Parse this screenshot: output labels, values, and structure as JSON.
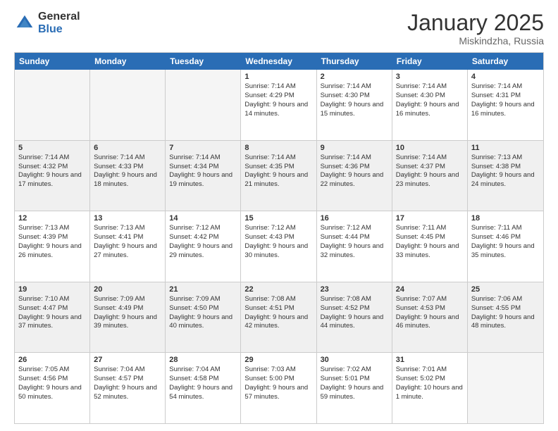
{
  "logo": {
    "general": "General",
    "blue": "Blue"
  },
  "title": "January 2025",
  "subtitle": "Miskindzha, Russia",
  "days": [
    "Sunday",
    "Monday",
    "Tuesday",
    "Wednesday",
    "Thursday",
    "Friday",
    "Saturday"
  ],
  "rows": [
    [
      {
        "day": "",
        "empty": true
      },
      {
        "day": "",
        "empty": true
      },
      {
        "day": "",
        "empty": true
      },
      {
        "day": "1",
        "sunrise": "Sunrise: 7:14 AM",
        "sunset": "Sunset: 4:29 PM",
        "daylight": "Daylight: 9 hours and 14 minutes."
      },
      {
        "day": "2",
        "sunrise": "Sunrise: 7:14 AM",
        "sunset": "Sunset: 4:30 PM",
        "daylight": "Daylight: 9 hours and 15 minutes."
      },
      {
        "day": "3",
        "sunrise": "Sunrise: 7:14 AM",
        "sunset": "Sunset: 4:30 PM",
        "daylight": "Daylight: 9 hours and 16 minutes."
      },
      {
        "day": "4",
        "sunrise": "Sunrise: 7:14 AM",
        "sunset": "Sunset: 4:31 PM",
        "daylight": "Daylight: 9 hours and 16 minutes."
      }
    ],
    [
      {
        "day": "5",
        "sunrise": "Sunrise: 7:14 AM",
        "sunset": "Sunset: 4:32 PM",
        "daylight": "Daylight: 9 hours and 17 minutes."
      },
      {
        "day": "6",
        "sunrise": "Sunrise: 7:14 AM",
        "sunset": "Sunset: 4:33 PM",
        "daylight": "Daylight: 9 hours and 18 minutes."
      },
      {
        "day": "7",
        "sunrise": "Sunrise: 7:14 AM",
        "sunset": "Sunset: 4:34 PM",
        "daylight": "Daylight: 9 hours and 19 minutes."
      },
      {
        "day": "8",
        "sunrise": "Sunrise: 7:14 AM",
        "sunset": "Sunset: 4:35 PM",
        "daylight": "Daylight: 9 hours and 21 minutes."
      },
      {
        "day": "9",
        "sunrise": "Sunrise: 7:14 AM",
        "sunset": "Sunset: 4:36 PM",
        "daylight": "Daylight: 9 hours and 22 minutes."
      },
      {
        "day": "10",
        "sunrise": "Sunrise: 7:14 AM",
        "sunset": "Sunset: 4:37 PM",
        "daylight": "Daylight: 9 hours and 23 minutes."
      },
      {
        "day": "11",
        "sunrise": "Sunrise: 7:13 AM",
        "sunset": "Sunset: 4:38 PM",
        "daylight": "Daylight: 9 hours and 24 minutes."
      }
    ],
    [
      {
        "day": "12",
        "sunrise": "Sunrise: 7:13 AM",
        "sunset": "Sunset: 4:39 PM",
        "daylight": "Daylight: 9 hours and 26 minutes."
      },
      {
        "day": "13",
        "sunrise": "Sunrise: 7:13 AM",
        "sunset": "Sunset: 4:41 PM",
        "daylight": "Daylight: 9 hours and 27 minutes."
      },
      {
        "day": "14",
        "sunrise": "Sunrise: 7:12 AM",
        "sunset": "Sunset: 4:42 PM",
        "daylight": "Daylight: 9 hours and 29 minutes."
      },
      {
        "day": "15",
        "sunrise": "Sunrise: 7:12 AM",
        "sunset": "Sunset: 4:43 PM",
        "daylight": "Daylight: 9 hours and 30 minutes."
      },
      {
        "day": "16",
        "sunrise": "Sunrise: 7:12 AM",
        "sunset": "Sunset: 4:44 PM",
        "daylight": "Daylight: 9 hours and 32 minutes."
      },
      {
        "day": "17",
        "sunrise": "Sunrise: 7:11 AM",
        "sunset": "Sunset: 4:45 PM",
        "daylight": "Daylight: 9 hours and 33 minutes."
      },
      {
        "day": "18",
        "sunrise": "Sunrise: 7:11 AM",
        "sunset": "Sunset: 4:46 PM",
        "daylight": "Daylight: 9 hours and 35 minutes."
      }
    ],
    [
      {
        "day": "19",
        "sunrise": "Sunrise: 7:10 AM",
        "sunset": "Sunset: 4:47 PM",
        "daylight": "Daylight: 9 hours and 37 minutes."
      },
      {
        "day": "20",
        "sunrise": "Sunrise: 7:09 AM",
        "sunset": "Sunset: 4:49 PM",
        "daylight": "Daylight: 9 hours and 39 minutes."
      },
      {
        "day": "21",
        "sunrise": "Sunrise: 7:09 AM",
        "sunset": "Sunset: 4:50 PM",
        "daylight": "Daylight: 9 hours and 40 minutes."
      },
      {
        "day": "22",
        "sunrise": "Sunrise: 7:08 AM",
        "sunset": "Sunset: 4:51 PM",
        "daylight": "Daylight: 9 hours and 42 minutes."
      },
      {
        "day": "23",
        "sunrise": "Sunrise: 7:08 AM",
        "sunset": "Sunset: 4:52 PM",
        "daylight": "Daylight: 9 hours and 44 minutes."
      },
      {
        "day": "24",
        "sunrise": "Sunrise: 7:07 AM",
        "sunset": "Sunset: 4:53 PM",
        "daylight": "Daylight: 9 hours and 46 minutes."
      },
      {
        "day": "25",
        "sunrise": "Sunrise: 7:06 AM",
        "sunset": "Sunset: 4:55 PM",
        "daylight": "Daylight: 9 hours and 48 minutes."
      }
    ],
    [
      {
        "day": "26",
        "sunrise": "Sunrise: 7:05 AM",
        "sunset": "Sunset: 4:56 PM",
        "daylight": "Daylight: 9 hours and 50 minutes."
      },
      {
        "day": "27",
        "sunrise": "Sunrise: 7:04 AM",
        "sunset": "Sunset: 4:57 PM",
        "daylight": "Daylight: 9 hours and 52 minutes."
      },
      {
        "day": "28",
        "sunrise": "Sunrise: 7:04 AM",
        "sunset": "Sunset: 4:58 PM",
        "daylight": "Daylight: 9 hours and 54 minutes."
      },
      {
        "day": "29",
        "sunrise": "Sunrise: 7:03 AM",
        "sunset": "Sunset: 5:00 PM",
        "daylight": "Daylight: 9 hours and 57 minutes."
      },
      {
        "day": "30",
        "sunrise": "Sunrise: 7:02 AM",
        "sunset": "Sunset: 5:01 PM",
        "daylight": "Daylight: 9 hours and 59 minutes."
      },
      {
        "day": "31",
        "sunrise": "Sunrise: 7:01 AM",
        "sunset": "Sunset: 5:02 PM",
        "daylight": "Daylight: 10 hours and 1 minute."
      },
      {
        "day": "",
        "empty": true
      }
    ]
  ]
}
